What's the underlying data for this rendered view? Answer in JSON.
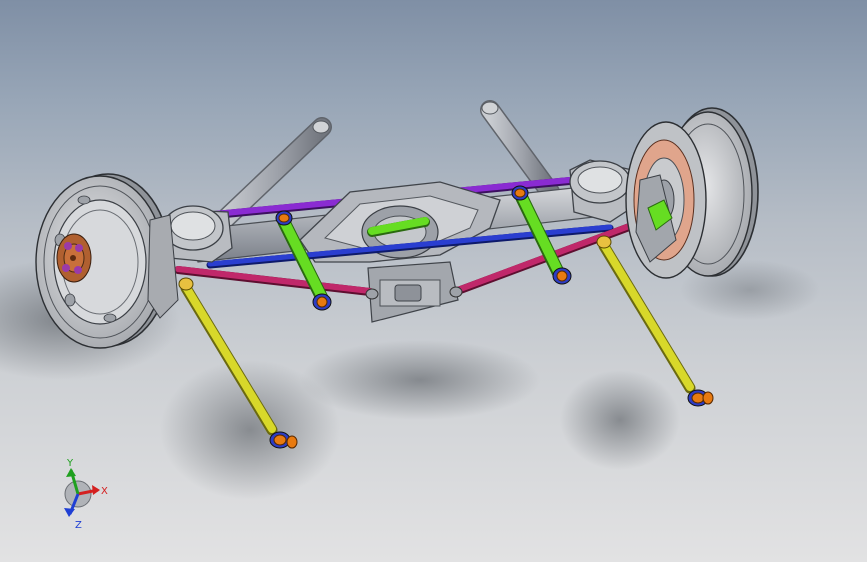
{
  "viewport": {
    "background_top": "#7f8fa5",
    "background_bottom": "#e2e2e3"
  },
  "triad": {
    "x_label": "X",
    "y_label": "Y",
    "z_label": "Z",
    "x_color": "#d42020",
    "y_color": "#1fa01f",
    "z_color": "#1f3fd4"
  },
  "model": {
    "axle_color": "#a9adb4",
    "wheel_color": "#c9cbce",
    "rotor_color": "#e0a58c",
    "hub_color": "#c8703a",
    "upper_link_color": "#8a2bd2",
    "lower_link_color": "#c0286a",
    "panhard_color": "#2a3ed0",
    "green_link_color": "#66dd22",
    "yellow_link_color": "#d8d82a",
    "bushing_color": "#e87a10",
    "bushing_inner_color": "#2c3cc4"
  }
}
